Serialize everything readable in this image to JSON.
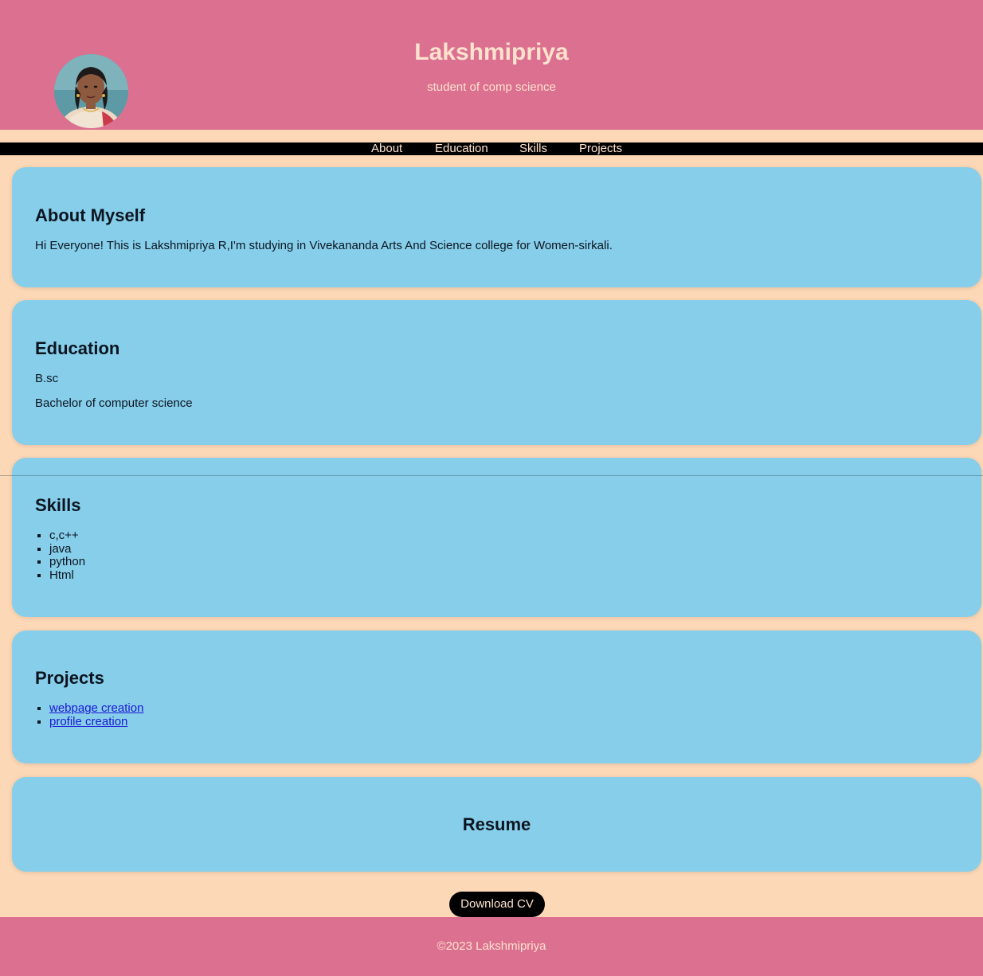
{
  "header": {
    "name": "Lakshmipriya",
    "subtitle": "student of comp science",
    "avatar_icon": "profile-photo"
  },
  "nav": {
    "items": [
      {
        "label": "About"
      },
      {
        "label": "Education"
      },
      {
        "label": "Skills"
      },
      {
        "label": "Projects"
      }
    ]
  },
  "about": {
    "heading": "About Myself",
    "text": "Hi Everyone! This is Lakshmipriya R,I'm studying in Vivekananda Arts And Science college for Women-sirkali."
  },
  "education": {
    "heading": "Education",
    "degree": "B.sc",
    "detail": "Bachelor of computer science"
  },
  "skills": {
    "heading": "Skills",
    "items": [
      "c,c++",
      "java",
      "python",
      "Html"
    ]
  },
  "projects": {
    "heading": "Projects",
    "items": [
      "webpage creation",
      "profile creation"
    ]
  },
  "resume": {
    "heading": "Resume",
    "button_label": "Download CV"
  },
  "footer": {
    "text": "©2023 Lakshmipriya"
  },
  "colors": {
    "header_bg": "#dc7091",
    "page_bg": "#fdd8b6",
    "card_bg": "#87ceea",
    "nav_bg": "#000000",
    "nav_text": "#fde2cd",
    "link": "#1a18d6"
  }
}
